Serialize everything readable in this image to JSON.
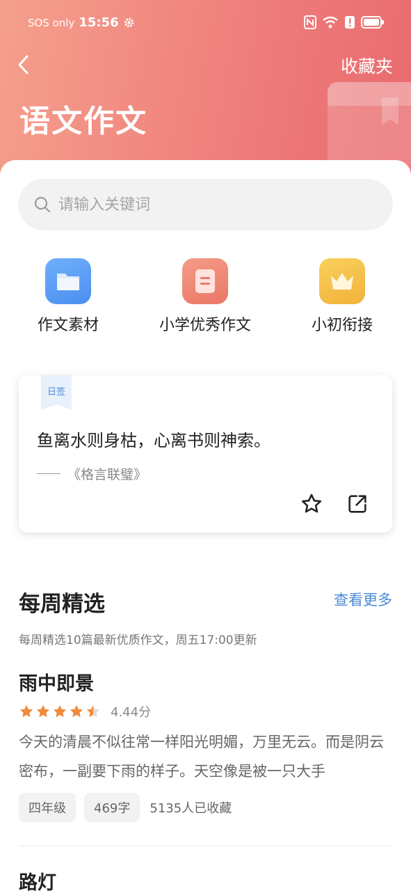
{
  "status_bar": {
    "carrier": "SOS only",
    "time": "15:56"
  },
  "header": {
    "back_label": "<",
    "favorites": "收藏夹",
    "title": "语文作文"
  },
  "search": {
    "placeholder": "请输入关键词"
  },
  "categories": [
    {
      "label": "作文素材",
      "icon": "folder-icon",
      "color": "#5b9cf5"
    },
    {
      "label": "小学优秀作文",
      "icon": "document-icon",
      "color": "#ee8a76"
    },
    {
      "label": "小初衔接",
      "icon": "crown-icon",
      "color": "#f6c04c"
    }
  ],
  "daily_quote": {
    "tag": "日签",
    "text": "鱼离水则身枯，心离书则神索。",
    "source": "《格言联璧》"
  },
  "weekly": {
    "title": "每周精选",
    "more": "查看更多",
    "subtitle": "每周精选10篇最新优质作文，周五17:00更新",
    "essays": [
      {
        "title": "雨中即景",
        "rating": 4.44,
        "score_text": "4.44分",
        "excerpt": "今天的清晨不似往常一样阳光明媚，万里无云。而是阴云密布，一副要下雨的样子。天空像是被一只大手",
        "grade": "四年级",
        "words": "469字",
        "collected": "5135人已收藏"
      },
      {
        "title": "路灯"
      }
    ]
  },
  "colors": {
    "accent": "#4a8ad6",
    "header_start": "#f5a08c",
    "header_end": "#e96a6e",
    "star": "#f08a3c"
  }
}
